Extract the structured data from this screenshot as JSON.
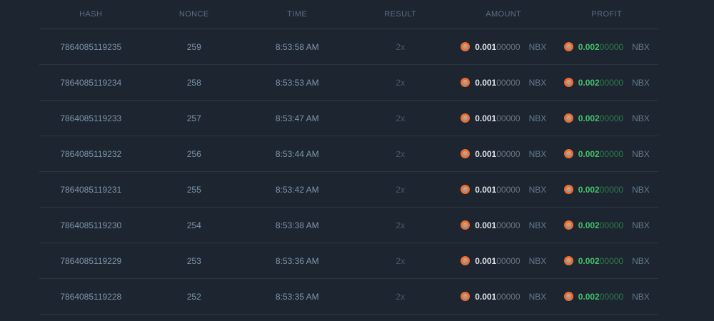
{
  "table": {
    "columns": [
      {
        "key": "hash",
        "label": "HASH"
      },
      {
        "key": "nonce",
        "label": "NONCE"
      },
      {
        "key": "time",
        "label": "TIME"
      },
      {
        "key": "result",
        "label": "RESULT"
      },
      {
        "key": "amount",
        "label": "AMOUNT"
      },
      {
        "key": "profit",
        "label": "PROFIT"
      }
    ],
    "rows": [
      {
        "hash": "7864085119235",
        "nonce": "259",
        "time": "8:53:58 AM",
        "result": "2x",
        "amount": {
          "main": "0.001",
          "zeros": "00000",
          "currency": "NBX"
        },
        "profit": {
          "main": "0.002",
          "zeros": "00000",
          "currency": "NBX"
        }
      },
      {
        "hash": "7864085119234",
        "nonce": "258",
        "time": "8:53:53 AM",
        "result": "2x",
        "amount": {
          "main": "0.001",
          "zeros": "00000",
          "currency": "NBX"
        },
        "profit": {
          "main": "0.002",
          "zeros": "00000",
          "currency": "NBX"
        }
      },
      {
        "hash": "7864085119233",
        "nonce": "257",
        "time": "8:53:47 AM",
        "result": "2x",
        "amount": {
          "main": "0.001",
          "zeros": "00000",
          "currency": "NBX"
        },
        "profit": {
          "main": "0.002",
          "zeros": "00000",
          "currency": "NBX"
        }
      },
      {
        "hash": "7864085119232",
        "nonce": "256",
        "time": "8:53:44 AM",
        "result": "2x",
        "amount": {
          "main": "0.001",
          "zeros": "00000",
          "currency": "NBX"
        },
        "profit": {
          "main": "0.002",
          "zeros": "00000",
          "currency": "NBX"
        }
      },
      {
        "hash": "7864085119231",
        "nonce": "255",
        "time": "8:53:42 AM",
        "result": "2x",
        "amount": {
          "main": "0.001",
          "zeros": "00000",
          "currency": "NBX"
        },
        "profit": {
          "main": "0.002",
          "zeros": "00000",
          "currency": "NBX"
        }
      },
      {
        "hash": "7864085119230",
        "nonce": "254",
        "time": "8:53:38 AM",
        "result": "2x",
        "amount": {
          "main": "0.001",
          "zeros": "00000",
          "currency": "NBX"
        },
        "profit": {
          "main": "0.002",
          "zeros": "00000",
          "currency": "NBX"
        }
      },
      {
        "hash": "7864085119229",
        "nonce": "253",
        "time": "8:53:36 AM",
        "result": "2x",
        "amount": {
          "main": "0.001",
          "zeros": "00000",
          "currency": "NBX"
        },
        "profit": {
          "main": "0.002",
          "zeros": "00000",
          "currency": "NBX"
        }
      },
      {
        "hash": "7864085119228",
        "nonce": "252",
        "time": "8:53:35 AM",
        "result": "2x",
        "amount": {
          "main": "0.001",
          "zeros": "00000",
          "currency": "NBX"
        },
        "profit": {
          "main": "0.002",
          "zeros": "00000",
          "currency": "NBX"
        }
      }
    ]
  },
  "icons": {
    "coin": "nbx-coin-icon"
  },
  "colors": {
    "background": "#1d2630",
    "divider": "#2a3642",
    "header_text": "#5c6e80",
    "body_text": "#7e94a9",
    "result_text": "#44586c",
    "amount_main": "#dde2e8",
    "amount_zeros": "#6b7582",
    "profit_main": "#45c06c",
    "profit_zeros": "#2d7b4d",
    "currency_text": "#63788c",
    "coin_orange": "#e96e35"
  }
}
